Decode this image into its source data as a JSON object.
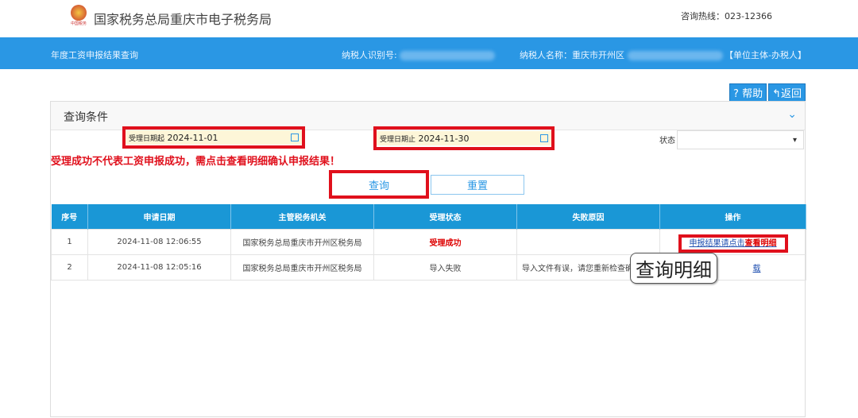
{
  "header": {
    "title": "国家税务总局重庆市电子税务局",
    "hotline": "咨询热线：023-12366"
  },
  "bar": {
    "page": "年度工资申报结果查询",
    "taxpayer_id_label": "纳税人识别号:",
    "taxpayer_name_label": "纳税人名称：重庆市开州区",
    "role": "【单位主体-办税人】"
  },
  "toolbar": {
    "help": "帮助",
    "back": "返回"
  },
  "query": {
    "title": "查询条件",
    "start_label": "受理日期起",
    "start_value": "2024-11-01",
    "end_label": "受理日期止",
    "end_value": "2024-11-30",
    "status_label": "状态",
    "warning": "受理成功不代表工资申报成功，需点击查看明细确认申报结果！",
    "search": "查询",
    "reset": "重置"
  },
  "table": {
    "headers": [
      "序号",
      "申请日期",
      "主管税务机关",
      "受理状态",
      "失败原因",
      "操作"
    ],
    "rows": [
      {
        "no": "1",
        "date": "2024-11-08 12:06:55",
        "office": "国家税务总局重庆市开州区税务局",
        "status": "受理成功",
        "reason": "",
        "action_pre": "申报结果请点击",
        "action_link": "查看明细"
      },
      {
        "no": "2",
        "date": "2024-11-08 12:05:16",
        "office": "国家税务总局重庆市开州区税务局",
        "status": "导入失败",
        "reason": "导入文件有误，请您重新检查确",
        "action_pre": "载",
        "action_link": ""
      }
    ]
  },
  "annotation": "查询明细"
}
